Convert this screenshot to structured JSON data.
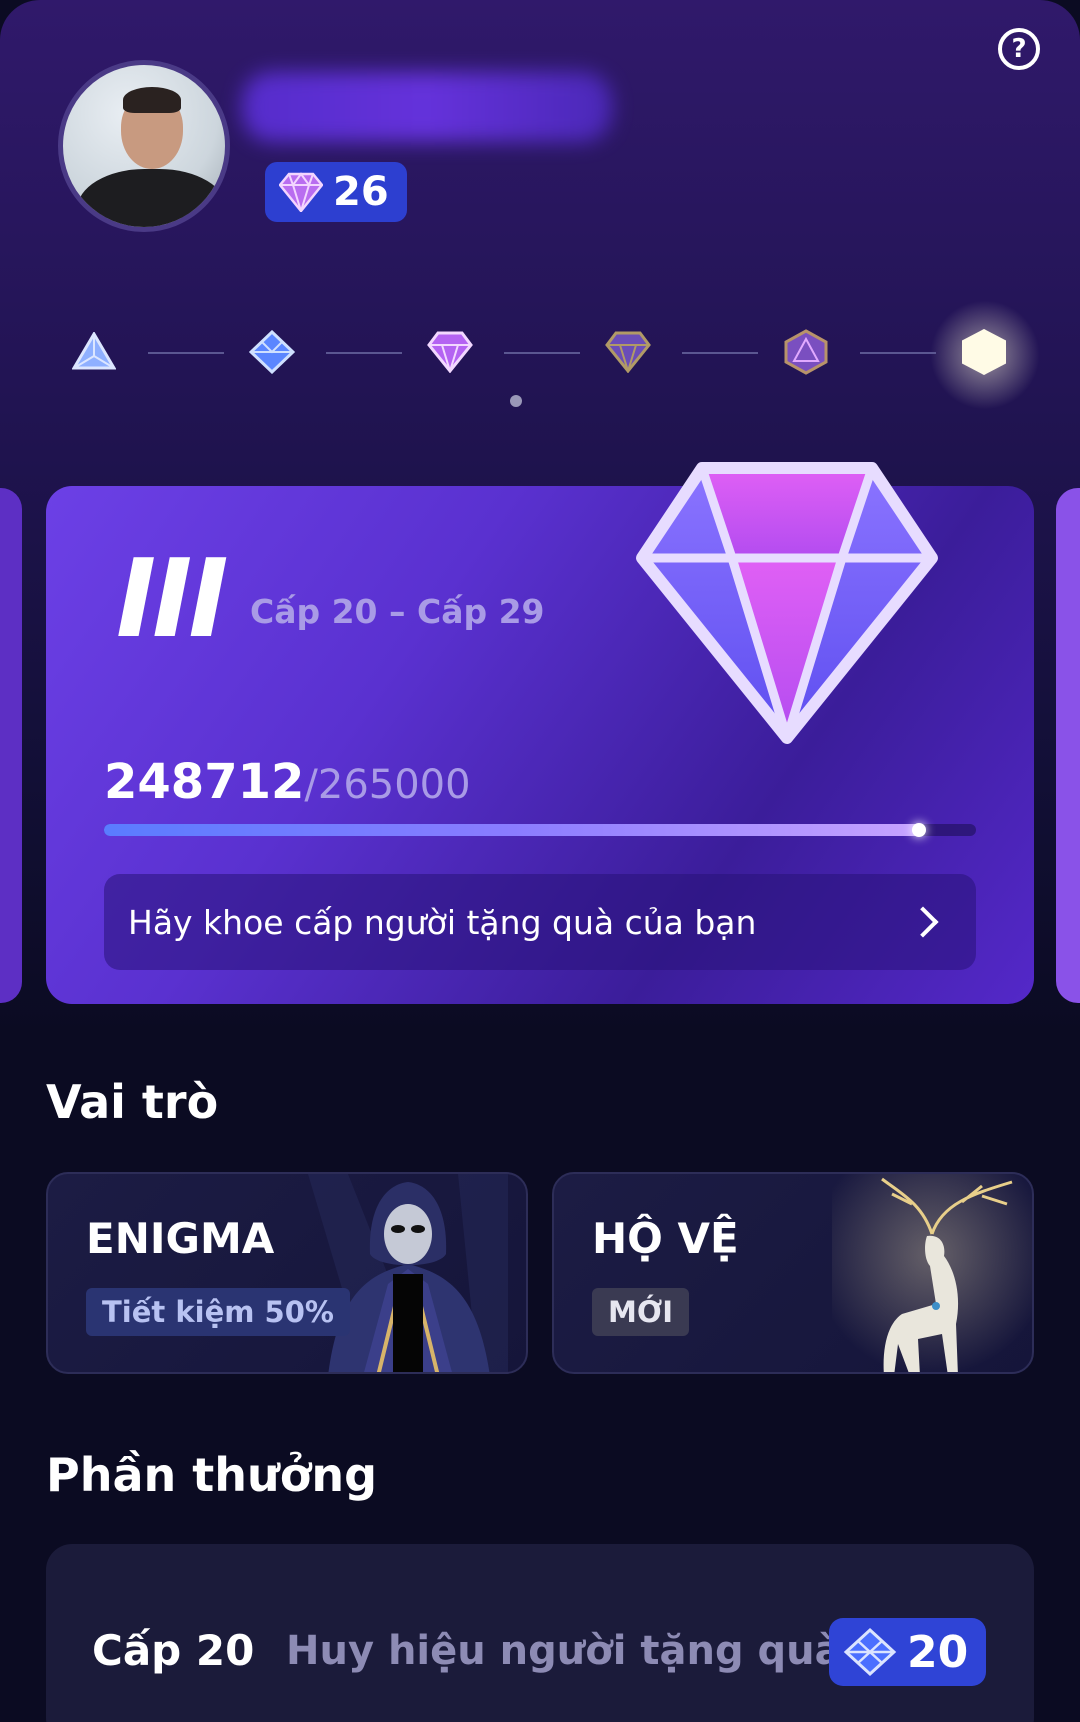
{
  "header": {
    "help_icon": "question-circle-icon",
    "gem_count": "26"
  },
  "tiers": {
    "items": [
      "tier-1-triangle-icon",
      "tier-2-blue-diamond-icon",
      "tier-3-purple-diamond-icon",
      "tier-4-dark-diamond-icon",
      "tier-5-bronze-gem-icon",
      "tier-6-white-hexagon-icon"
    ],
    "current_index": 2
  },
  "level_card": {
    "roman": "III",
    "range": "Cấp 20 – Cấp 29",
    "current": "248712",
    "total": "/265000",
    "progress_fraction": 0.9385,
    "share_label": "Hãy khoe cấp người tặng quà của bạn"
  },
  "roles": {
    "title": "Vai trò",
    "items": [
      {
        "name": "ENIGMA",
        "tag": "Tiết kiệm 50%"
      },
      {
        "name": "HỘ VỆ",
        "tag": "MỚI"
      }
    ]
  },
  "rewards": {
    "title": "Phần thưởng",
    "items": [
      {
        "level": "Cấp 20",
        "name": "Huy hiệu người tặng quà",
        "badge": "20"
      }
    ]
  },
  "colors": {
    "accent_blue": "#2f44d6",
    "card_purple": "#5a31d0",
    "background": "#0b0b22"
  }
}
